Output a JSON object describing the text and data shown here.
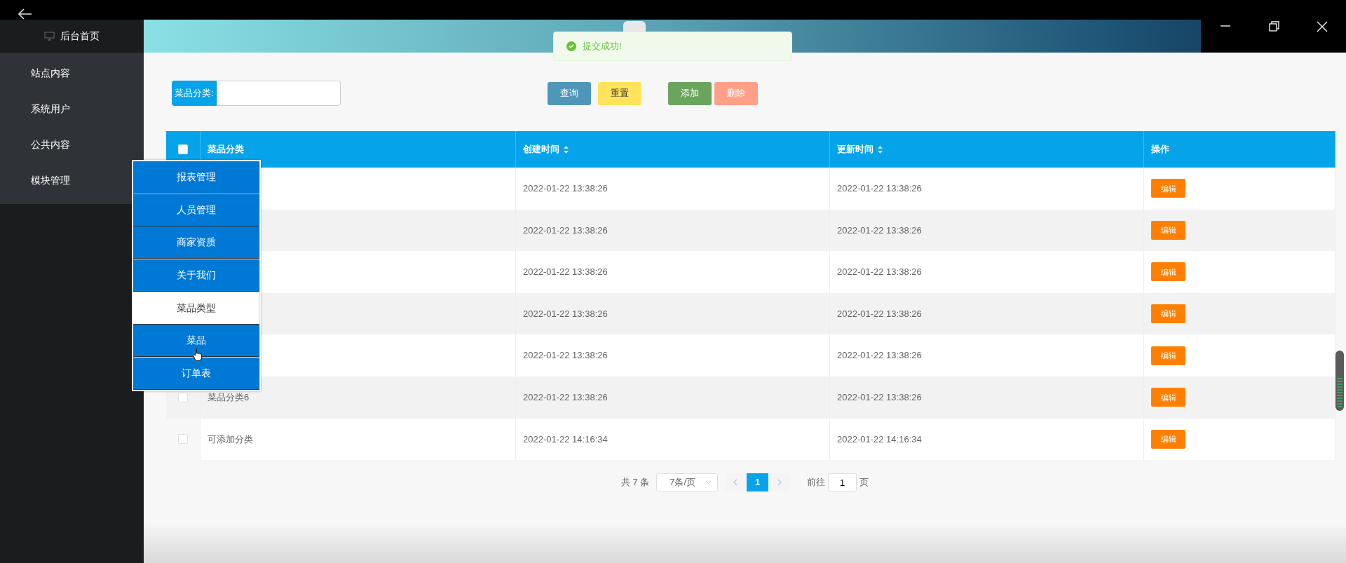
{
  "window": {
    "controls": [
      {
        "kind": "back"
      },
      {
        "kind": "minimize"
      },
      {
        "kind": "restore"
      },
      {
        "kind": "close"
      }
    ]
  },
  "sidebar": {
    "home": "后台首页",
    "items": [
      {
        "label": "站点内容"
      },
      {
        "label": "系统用户"
      },
      {
        "label": "公共内容"
      },
      {
        "label": "模块管理"
      }
    ]
  },
  "dropdown": {
    "items": [
      {
        "label": "报表管理",
        "selected": false
      },
      {
        "label": "人员管理",
        "selected": false
      },
      {
        "label": "商家资质",
        "selected": false
      },
      {
        "label": "关于我们",
        "selected": false
      },
      {
        "label": "菜品类型",
        "selected": true
      },
      {
        "label": "菜品",
        "selected": false,
        "hovered": true
      },
      {
        "label": "订单表",
        "selected": false
      }
    ]
  },
  "toast": {
    "kind": "success",
    "message": "提交成功!"
  },
  "search": {
    "label": "菜品分类:"
  },
  "buttons": [
    {
      "label": "查询",
      "color": "#4f97b9"
    },
    {
      "label": "重置",
      "color": "#ffe35a"
    },
    {
      "label": "添加",
      "color": "#6ba45c"
    },
    {
      "label": "删除",
      "color": "#ff9f88"
    }
  ],
  "table": {
    "select_all": {
      "checked": false
    },
    "columns": [
      {
        "label": "菜品分类",
        "sortable": false
      },
      {
        "label": "创建时间",
        "sortable": true
      },
      {
        "label": "更新时间",
        "sortable": true
      },
      {
        "label": "操作",
        "sortable": false
      }
    ],
    "rows": [
      {
        "created": "2022-01-22 13:38:26",
        "updated": "2022-01-22 13:38:26",
        "action": "编辑"
      },
      {
        "created": "2022-01-22 13:38:26",
        "updated": "2022-01-22 13:38:26",
        "action": "编辑"
      },
      {
        "created": "2022-01-22 13:38:26",
        "updated": "2022-01-22 13:38:26",
        "action": "编辑"
      },
      {
        "created": "2022-01-22 13:38:26",
        "updated": "2022-01-22 13:38:26",
        "action": "编辑"
      },
      {
        "created": "2022-01-22 13:38:26",
        "updated": "2022-01-22 13:38:26",
        "action": "编辑"
      },
      {
        "checked": false,
        "category": "菜品分类6",
        "created": "2022-01-22 13:38:26",
        "updated": "2022-01-22 13:38:26",
        "action": "编辑"
      },
      {
        "checked": false,
        "category": "可添加分类",
        "created": "2022-01-22 14:16:34",
        "updated": "2022-01-22 14:16:34",
        "action": "编辑"
      }
    ]
  },
  "pagination": {
    "total": "共 7 条",
    "page_size": "7条/页",
    "pages": [
      {
        "label": "1",
        "selected": true
      }
    ],
    "goto_label": "前往",
    "goto_value": "1",
    "goto_suffix": "页"
  }
}
